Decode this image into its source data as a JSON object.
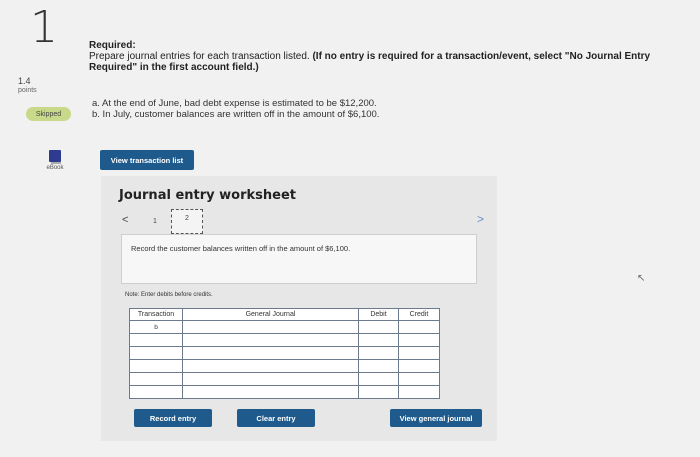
{
  "question": {
    "number": "1",
    "points_value": "1.4",
    "points_label": "points",
    "status": "Skipped",
    "ebook_label": "eBook"
  },
  "required": {
    "heading": "Required:",
    "instruction": "Prepare journal entries for each transaction listed.",
    "instruction_bold": "(If no entry is required for a transaction/event, select \"No Journal Entry Required\" in the first account field.)"
  },
  "transactions": [
    "a. At the end of June, bad debt expense is estimated to be $12,200.",
    "b. In July, customer balances are written off in the amount of $6,100."
  ],
  "view_transaction_list": "View transaction list",
  "worksheet": {
    "title": "Journal entry worksheet",
    "pages": [
      "1",
      "2"
    ],
    "current_page": 2,
    "prev_symbol": "<",
    "next_symbol": ">",
    "record_text": "Record the customer balances written off in the amount of $6,100.",
    "note": "Note: Enter debits before credits.",
    "columns": [
      "Transaction",
      "General Journal",
      "Debit",
      "Credit"
    ],
    "rows": [
      {
        "transaction": "b",
        "account": "",
        "debit": "",
        "credit": ""
      },
      {
        "transaction": "",
        "account": "",
        "debit": "",
        "credit": ""
      },
      {
        "transaction": "",
        "account": "",
        "debit": "",
        "credit": ""
      },
      {
        "transaction": "",
        "account": "",
        "debit": "",
        "credit": ""
      },
      {
        "transaction": "",
        "account": "",
        "debit": "",
        "credit": ""
      },
      {
        "transaction": "",
        "account": "",
        "debit": "",
        "credit": ""
      }
    ],
    "record_entry": "Record entry",
    "clear_entry": "Clear entry",
    "view_general_journal": "View general journal"
  }
}
